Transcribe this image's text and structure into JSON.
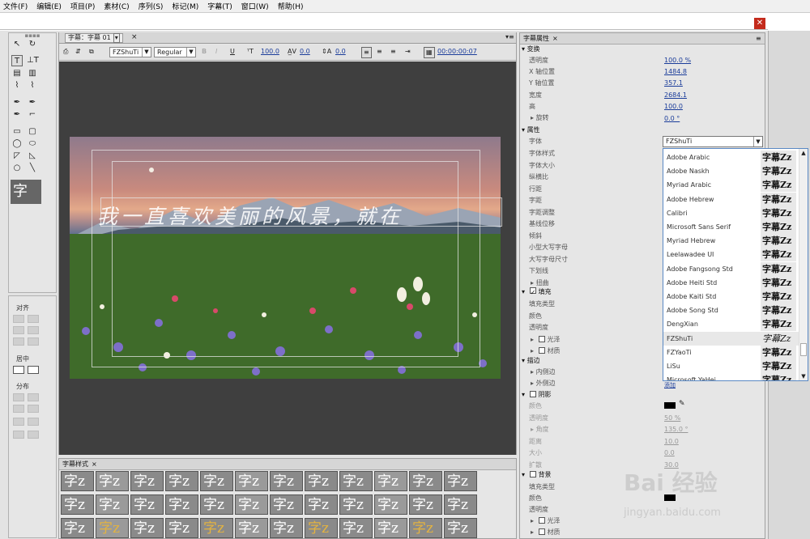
{
  "menu": [
    "文件(F)",
    "编辑(E)",
    "项目(P)",
    "素材(C)",
    "序列(S)",
    "标记(M)",
    "字幕(T)",
    "窗口(W)",
    "帮助(H)"
  ],
  "editor": {
    "tab_label": "字幕：字幕 01",
    "font_value": "FZShuTi",
    "style_value": "Regular",
    "size_value": "100.0",
    "kerning_value": "0.0",
    "leading_value": "0.0",
    "timecode": "00:00:00:07",
    "title_text": "我一直喜欢美丽的风景，就在"
  },
  "tools_preview": "字",
  "actions": {
    "align": "对齐",
    "center": "居中",
    "distribute": "分布"
  },
  "styles_panel": {
    "tab_label": "字幕样式",
    "swatch": "字z"
  },
  "props": {
    "tab_label": "字幕属性",
    "transform": "变换",
    "rows": [
      {
        "label": "透明度",
        "value": "100.0 %"
      },
      {
        "label": "X 轴位置",
        "value": "1484.8"
      },
      {
        "label": "Y 轴位置",
        "value": "357.1"
      },
      {
        "label": "宽度",
        "value": "2684.1"
      },
      {
        "label": "高",
        "value": "100.0"
      },
      {
        "label": "旋转",
        "value": "0.0 °"
      }
    ],
    "attributes": "属性",
    "font_label": "字体",
    "font_value": "FZShuTi",
    "attr_rows": [
      "字体样式",
      "字体大小",
      "纵横比",
      "行距",
      "字距",
      "字距调整",
      "基线位移",
      "倾斜",
      "小型大写字母",
      "大写字母尺寸",
      "下划线",
      "扭曲"
    ],
    "fill": "填充",
    "fill_rows": [
      "填充类型",
      "颜色",
      "透明度",
      "光泽",
      "材质"
    ],
    "stroke": "描边",
    "stroke_rows": [
      "内侧边",
      "外侧边"
    ],
    "stroke_add": "添加",
    "shadow": "阴影",
    "shadow_rows": [
      {
        "label": "颜色",
        "value": ""
      },
      {
        "label": "透明度",
        "value": "50 %"
      },
      {
        "label": "角度",
        "value": "135.0 °"
      },
      {
        "label": "距离",
        "value": "10.0"
      },
      {
        "label": "大小",
        "value": "0.0"
      },
      {
        "label": "扩散",
        "value": "30.0"
      }
    ],
    "background": "背景",
    "bg_rows": [
      "填充类型",
      "颜色",
      "透明度",
      "光泽",
      "材质"
    ]
  },
  "font_list": {
    "preview": "字幕Zz",
    "items": [
      "Adobe Arabic",
      "Adobe Naskh",
      "Myriad Arabic",
      "Adobe Hebrew",
      "Calibri",
      "Microsoft Sans Serif",
      "Myriad Hebrew",
      "Leelawadee UI",
      "Adobe Fangsong Std",
      "Adobe Heiti Std",
      "Adobe Kaiti Std",
      "Adobe Song Std",
      "DengXian",
      "FZShuTi",
      "FZYaoTi",
      "LiSu",
      "Microsoft YaHei"
    ],
    "selected": "FZShuTi"
  },
  "watermark": {
    "brand": "Bai 经验",
    "url": "jingyan.baidu.com"
  }
}
